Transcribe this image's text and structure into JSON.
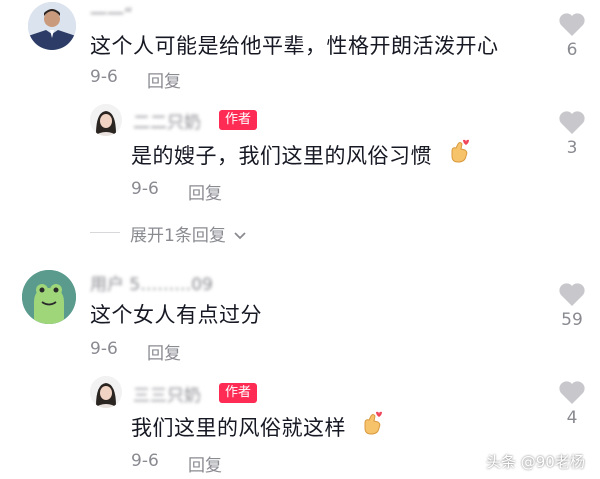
{
  "comments": [
    {
      "name": "一一“",
      "text": "这个人可能是给他平辈，性格开朗活泼开心",
      "date": "9-6",
      "reply": "回复",
      "likes": "6"
    },
    {
      "name": "二二只奶",
      "badge": "作者",
      "text": "是的嫂子，我们这里的风俗习惯",
      "emoji": "finger-heart-icon",
      "date": "9-6",
      "reply": "回复",
      "likes": "3"
    },
    {
      "name": "用户 5………09",
      "text": "这个女人有点过分",
      "date": "9-6",
      "reply": "回复",
      "likes": "59"
    },
    {
      "name": "三三只奶",
      "badge": "作者",
      "text": "我们这里的风俗就这样",
      "emoji": "finger-heart-icon",
      "date": "9-6",
      "reply": "回复",
      "likes": "4"
    }
  ],
  "expand_label": "展开1条回复",
  "watermark": "头条 @90老杨",
  "colors": {
    "badge": "#fe2c55",
    "muted": "#8a8b91",
    "heart": "#c8c8cc",
    "avatar_green": "#5a9b8e"
  }
}
